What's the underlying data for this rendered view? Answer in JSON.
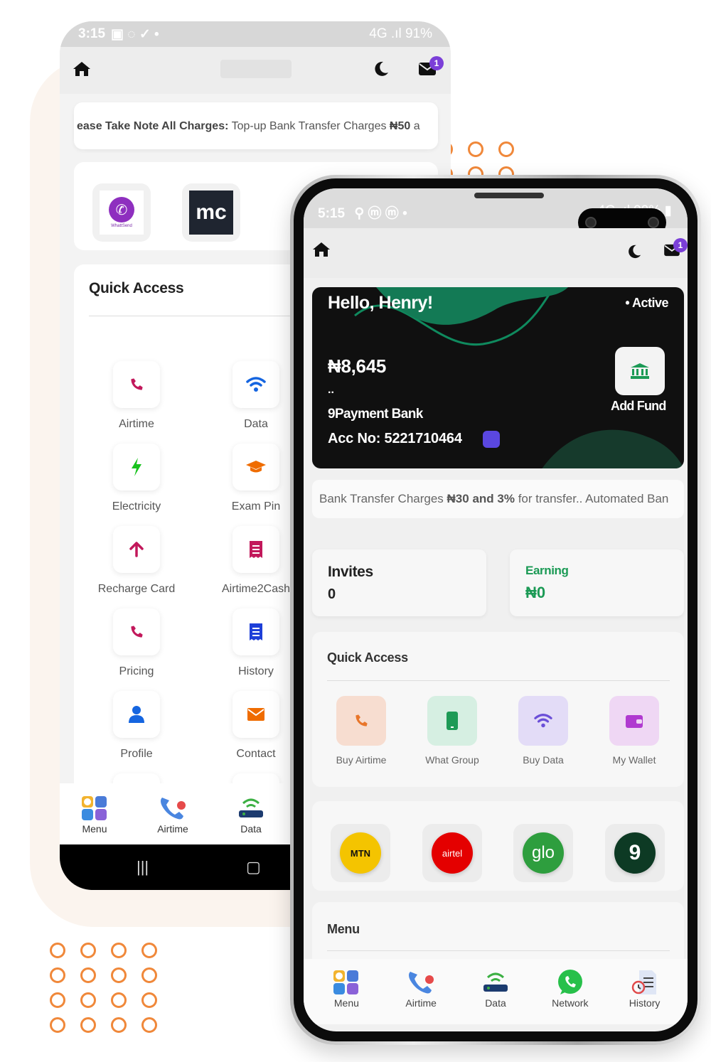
{
  "back_screen": {
    "status": {
      "time": "3:15",
      "icons": "▣ ◌ ✓ •",
      "right": "4G .ıl 91%"
    },
    "header": {
      "mail_badge": "1"
    },
    "notice": {
      "bold": "ease Take Note All Charges:",
      "text": " Top-up Bank Transfer Charges ",
      "amount": "₦50",
      "tail": " a"
    },
    "logos": [
      {
        "name": "WhattSend",
        "caption": "WhattSend"
      },
      {
        "name": "mc",
        "caption": "mc"
      }
    ],
    "quick_access": {
      "title": "Quick Access",
      "items": [
        {
          "label": "Airtime",
          "icon": "phone-icon",
          "color": "#c2185b"
        },
        {
          "label": "Data",
          "icon": "wifi-icon",
          "color": "#1565e0"
        },
        {
          "label": "Electricity",
          "icon": "bolt-icon",
          "color": "#18c21d"
        },
        {
          "label": "Exam Pin",
          "icon": "graduation-cap-icon",
          "color": "#ef6c00"
        },
        {
          "label": "Recharge Card",
          "icon": "arrow-up-icon",
          "color": "#c2185b"
        },
        {
          "label": "Airtime2Cash",
          "icon": "receipt-icon",
          "color": "#c2185b"
        },
        {
          "label": "Pricing",
          "icon": "phone-icon",
          "color": "#c2185b"
        },
        {
          "label": "History",
          "icon": "receipt-icon",
          "color": "#1e3fd8"
        },
        {
          "label": "Profile",
          "icon": "user-icon",
          "color": "#1565e0"
        },
        {
          "label": "Contact",
          "icon": "envelope-icon",
          "color": "#ef6c00"
        }
      ]
    },
    "nav": [
      {
        "label": "Menu",
        "icon": "menu-grid-icon"
      },
      {
        "label": "Airtime",
        "icon": "airtime-phone-icon"
      },
      {
        "label": "Data",
        "icon": "data-router-icon"
      }
    ],
    "sysbar": {
      "recent": "|||",
      "home": "▢"
    }
  },
  "front_screen": {
    "status": {
      "time": "5:15",
      "icons": "⚲ ⓜ ⓜ •",
      "right": "4G .ıl 99% ▮"
    },
    "header": {
      "mail_badge": "1"
    },
    "card": {
      "greeting": "Hello, Henry!",
      "status": "• Active",
      "balance": "₦8,645",
      "mask": "..",
      "bank": "9Payment Bank",
      "account": "Acc No: 5221710464",
      "add_fund": "Add Fund"
    },
    "notice": {
      "lead": "Bank Transfer Charges ",
      "amount": "₦30 and 3%",
      "tail": " for transfer.. Automated Ban"
    },
    "invites": {
      "title": "Invites",
      "value": "0"
    },
    "earning": {
      "title": "Earning",
      "value": "₦0"
    },
    "quick_access": {
      "title": "Quick Access",
      "items": [
        {
          "label": "Buy Airtime",
          "icon": "phone-icon",
          "bg": "#f7ddd0",
          "color": "#e8762b"
        },
        {
          "label": "What Group",
          "icon": "mobile-icon",
          "bg": "#d6efe2",
          "color": "#1e9a56"
        },
        {
          "label": "Buy Data",
          "icon": "wifi-icon",
          "bg": "#e3dcf7",
          "color": "#6b4fd8"
        },
        {
          "label": "My Wallet",
          "icon": "wallet-icon",
          "bg": "#efd7f4",
          "color": "#b03ad0"
        }
      ]
    },
    "networks": [
      {
        "name": "MTN",
        "bg": "#f4c400",
        "color": "#111"
      },
      {
        "name": "airtel",
        "bg": "#e40000",
        "color": "#fff"
      },
      {
        "name": "glo",
        "bg": "#2e9e3e",
        "color": "#fff"
      },
      {
        "name": "9",
        "bg": "#0d3a24",
        "color": "#fff"
      }
    ],
    "menu": {
      "title": "Menu"
    },
    "nav": [
      {
        "label": "Menu",
        "icon": "menu-grid-icon"
      },
      {
        "label": "Airtime",
        "icon": "airtime-phone-icon"
      },
      {
        "label": "Data",
        "icon": "data-router-icon"
      },
      {
        "label": "Network",
        "icon": "whatsapp-icon"
      },
      {
        "label": "History",
        "icon": "history-doc-icon"
      }
    ]
  }
}
